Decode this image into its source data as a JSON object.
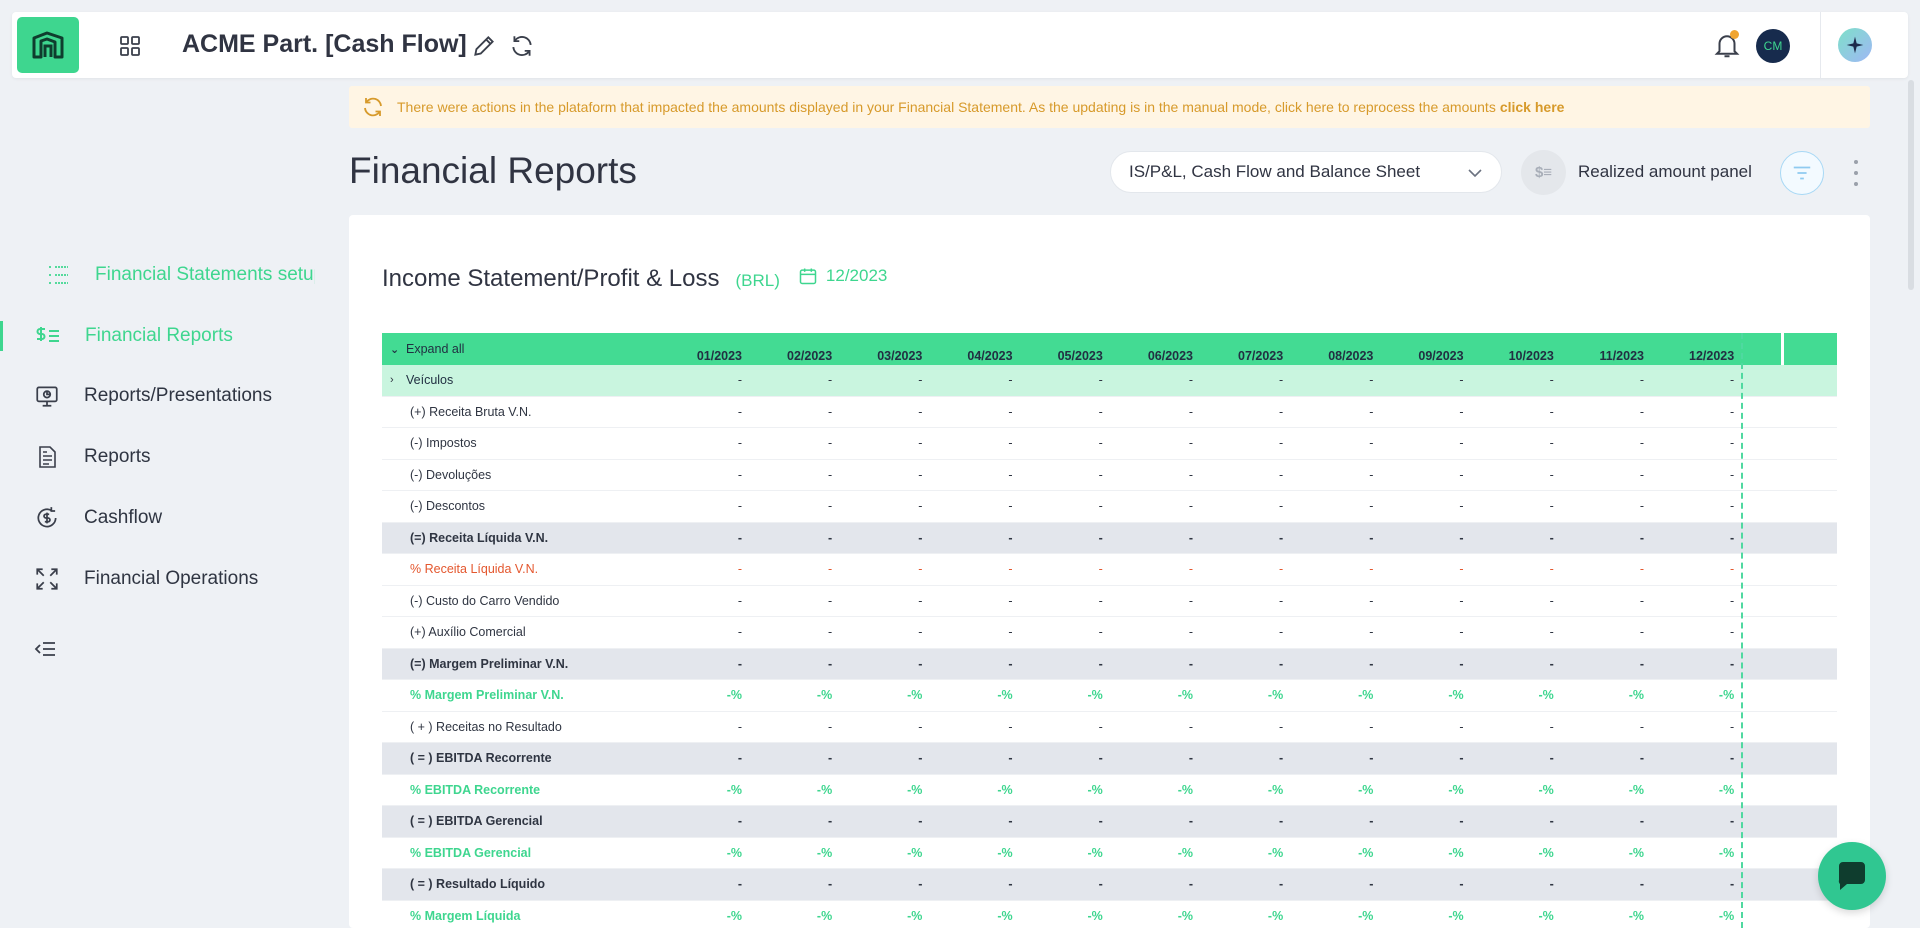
{
  "header": {
    "app_title": "ACME Part. [Cash Flow]",
    "avatar_initials": "CM"
  },
  "alert": {
    "message": "There were actions in the plataform that impacted the amounts displayed in your Financial Statement. As the updating is in the manual mode, click here to reprocess the amounts",
    "link": "click here"
  },
  "sidebar": {
    "items": [
      {
        "label": "Financial Statements setup"
      },
      {
        "label": "Financial Reports"
      },
      {
        "label": "Reports/Presentations"
      },
      {
        "label": "Reports"
      },
      {
        "label": "Cashflow"
      },
      {
        "label": "Financial Operations"
      }
    ]
  },
  "page": {
    "title": "Financial Reports",
    "view_select": "IS/P&L, Cash Flow and Balance Sheet",
    "realized_icon": "$≡",
    "realized_label": "Realized amount panel"
  },
  "report": {
    "title": "Income Statement/Profit & Loss",
    "currency": "(BRL)",
    "date": "12/2023",
    "expand_all": "Expand all",
    "months": [
      "01/2023",
      "02/2023",
      "03/2023",
      "04/2023",
      "05/2023",
      "06/2023",
      "07/2023",
      "08/2023",
      "09/2023",
      "10/2023",
      "11/2023",
      "12/2023"
    ],
    "rows": [
      {
        "label": "Veículos",
        "type": "group",
        "value": "-"
      },
      {
        "label": "(+) Receita Bruta V.N.",
        "type": "normal",
        "value": "-"
      },
      {
        "label": "(-) Impostos",
        "type": "normal",
        "value": "-"
      },
      {
        "label": "(-) Devoluções",
        "type": "normal",
        "value": "-"
      },
      {
        "label": "(-) Descontos",
        "type": "normal",
        "value": "-"
      },
      {
        "label": "(=) Receita Líquida V.N.",
        "type": "subtotal",
        "value": "-"
      },
      {
        "label": "% Receita Líquida V.N.",
        "type": "red",
        "value": "-"
      },
      {
        "label": "(-) Custo do Carro Vendido",
        "type": "normal",
        "value": "-"
      },
      {
        "label": "(+) Auxílio Comercial",
        "type": "normal",
        "value": "-"
      },
      {
        "label": "(=) Margem Preliminar V.N.",
        "type": "subtotal",
        "value": "-"
      },
      {
        "label": "% Margem Preliminar V.N.",
        "type": "green",
        "value": "-%"
      },
      {
        "label": "( + ) Receitas no Resultado",
        "type": "normal",
        "value": "-"
      },
      {
        "label": "( = ) EBITDA Recorrente",
        "type": "subtotal",
        "value": "-"
      },
      {
        "label": "% EBITDA Recorrente",
        "type": "green",
        "value": "-%"
      },
      {
        "label": "( = ) EBITDA Gerencial",
        "type": "subtotal",
        "value": "-"
      },
      {
        "label": "% EBITDA Gerencial",
        "type": "green",
        "value": "-%"
      },
      {
        "label": "( = ) Resultado Líquido",
        "type": "subtotal",
        "value": "-"
      },
      {
        "label": "% Margem Líquida",
        "type": "green",
        "value": "-%"
      }
    ]
  },
  "colors": {
    "accent": "#3ed68f",
    "header_row": "#43db93",
    "group_row": "#c9f5df",
    "subtotal_row": "#e3e6ec",
    "negative_text": "#e4572e",
    "alert_bg": "#fff5e4",
    "alert_text": "#d79a2b"
  },
  "icons": [
    "logo-icon",
    "apps-grid-icon",
    "edit-pencil-icon",
    "refresh-icon",
    "bell-icon",
    "avatar",
    "ai-sparkle-icon",
    "list-setup-icon",
    "dollar-list-icon",
    "presentation-icon",
    "report-document-icon",
    "cashflow-icon",
    "expand-arrows-icon",
    "collapse-menu-icon",
    "calendar-icon",
    "chevron-down-icon",
    "filter-icon",
    "more-vertical-icon",
    "chat-icon"
  ]
}
